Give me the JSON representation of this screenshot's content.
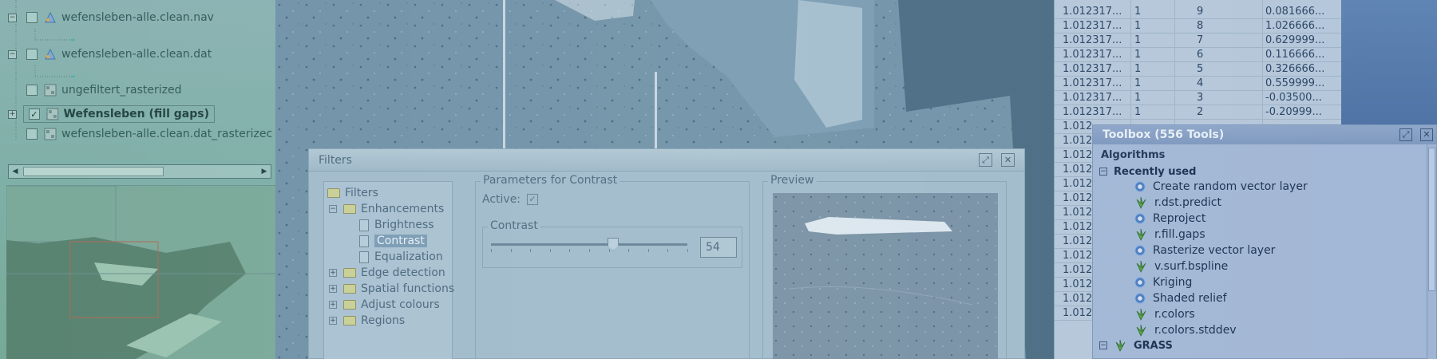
{
  "layers_panel": {
    "layers": [
      {
        "label": "wefensleben-alle.clean.nav",
        "checked": false,
        "icon": "vector-layer-icon"
      },
      {
        "label": "wefensleben-alle.clean.dat",
        "checked": false,
        "icon": "vector-layer-icon"
      },
      {
        "label": "ungefiltert_rasterized",
        "checked": false,
        "icon": "raster-layer-icon"
      },
      {
        "label": "Wefensleben (fill gaps)",
        "checked": true,
        "icon": "raster-layer-icon"
      },
      {
        "label": "wefensleben-alle.clean.dat_rasterizec",
        "checked": false,
        "icon": "raster-layer-icon"
      }
    ],
    "check_mark": "✓",
    "plus_sign": "+",
    "scroll_left": "◀",
    "scroll_right": "▶"
  },
  "filters_dialog": {
    "title": "Filters",
    "tree": {
      "root": "Filters",
      "enhancements": "Enhancements",
      "brightness": "Brightness",
      "contrast": "Contrast",
      "equalization": "Equalization",
      "edge_detection": "Edge detection",
      "spatial_functions": "Spatial functions",
      "adjust_colours": "Adjust colours",
      "regions": "Regions",
      "minus": "−",
      "plus": "+"
    },
    "params": {
      "group_title": "Parameters for Contrast",
      "active_label": "Active:",
      "active_checked": true,
      "contrast_title": "Contrast",
      "contrast_value": "54",
      "contrast_level": 54
    },
    "preview_title": "Preview",
    "maximize_glyph": "⤢",
    "close_glyph": "✕"
  },
  "attribute_table": {
    "rows": [
      [
        "1.012317...",
        "1",
        "8",
        "1.026666..."
      ],
      [
        "1.012317...",
        "1",
        "7",
        "0.629999..."
      ],
      [
        "1.012317...",
        "1",
        "6",
        "0.116666..."
      ],
      [
        "1.012317...",
        "1",
        "5",
        "0.326666..."
      ],
      [
        "1.012317...",
        "1",
        "4",
        "0.559999..."
      ],
      [
        "1.012317...",
        "1",
        "3",
        "-0.03500..."
      ],
      [
        "1.012317...",
        "1",
        "2",
        "-0.20999..."
      ]
    ],
    "top_row": [
      "1.012317...",
      "1",
      "9",
      "0.081666..."
    ],
    "truncated_cell": "1.012"
  },
  "toolbox": {
    "title": "Toolbox (556 Tools)",
    "algorithms_label": "Algorithms",
    "recently_used": "Recently used",
    "items": [
      {
        "label": "Create random vector layer",
        "icon": "gear-icon"
      },
      {
        "label": "r.dst.predict",
        "icon": "grass-icon"
      },
      {
        "label": "Reproject",
        "icon": "gear-icon"
      },
      {
        "label": "r.fill.gaps",
        "icon": "grass-icon"
      },
      {
        "label": "Rasterize vector layer",
        "icon": "gear-icon"
      },
      {
        "label": "v.surf.bspline",
        "icon": "grass-icon"
      },
      {
        "label": "Kriging",
        "icon": "gear-icon"
      },
      {
        "label": "Shaded relief",
        "icon": "gear-icon"
      },
      {
        "label": "r.colors",
        "icon": "grass-icon"
      },
      {
        "label": "r.colors.stddev",
        "icon": "grass-icon"
      }
    ],
    "grass_group": "GRASS",
    "minus": "−",
    "undock_glyph": "⤢",
    "close_glyph": "✕"
  },
  "colors": {
    "left_panel": "#7fb0a7",
    "map_bg": "#6e8ea3",
    "dialog_bg": "#a2bccc",
    "toolbox_title": "#7f99bf",
    "selection": "#7d9db6"
  }
}
